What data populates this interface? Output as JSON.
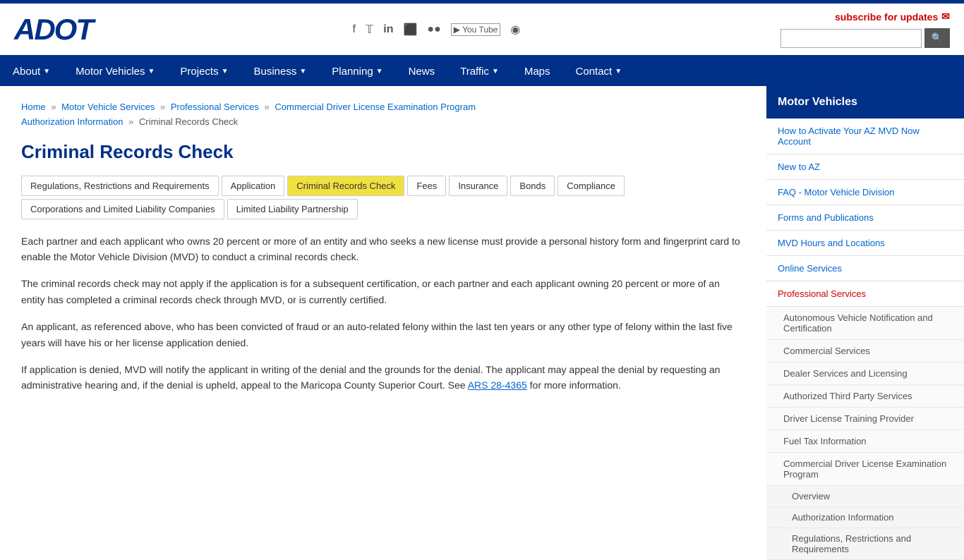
{
  "top_strip": "",
  "logo": {
    "text": "ADOT"
  },
  "social": {
    "icons": [
      {
        "name": "facebook",
        "symbol": "f"
      },
      {
        "name": "twitter",
        "symbol": "𝕏"
      },
      {
        "name": "linkedin",
        "symbol": "in"
      },
      {
        "name": "instagram",
        "symbol": "📷"
      },
      {
        "name": "flickr",
        "symbol": "✿✿"
      },
      {
        "name": "youtube",
        "symbol": "▶"
      },
      {
        "name": "rss",
        "symbol": "◉"
      }
    ]
  },
  "top_right": {
    "subscribe_label": "subscribe for updates",
    "search_placeholder": ""
  },
  "search_btn_label": "🔍",
  "nav": {
    "items": [
      {
        "label": "About",
        "has_arrow": true
      },
      {
        "label": "Motor Vehicles",
        "has_arrow": true
      },
      {
        "label": "Projects",
        "has_arrow": true
      },
      {
        "label": "Business",
        "has_arrow": true
      },
      {
        "label": "Planning",
        "has_arrow": true
      },
      {
        "label": "News",
        "has_arrow": false
      },
      {
        "label": "Traffic",
        "has_arrow": true
      },
      {
        "label": "Maps",
        "has_arrow": false
      },
      {
        "label": "Contact",
        "has_arrow": true
      }
    ]
  },
  "breadcrumb": {
    "items": [
      {
        "label": "Home",
        "href": "#"
      },
      {
        "label": "Motor Vehicle Services",
        "href": "#"
      },
      {
        "label": "Professional Services",
        "href": "#"
      },
      {
        "label": "Commercial Driver License Examination Program",
        "href": "#"
      },
      {
        "label": "Authorization Information",
        "href": "#"
      },
      {
        "label": "Criminal Records Check",
        "href": "#",
        "current": true
      }
    ]
  },
  "page_title": "Criminal Records Check",
  "tabs": [
    {
      "label": "Regulations, Restrictions and Requirements",
      "active": false
    },
    {
      "label": "Application",
      "active": false
    },
    {
      "label": "Criminal Records Check",
      "active": true
    },
    {
      "label": "Fees",
      "active": false
    },
    {
      "label": "Insurance",
      "active": false
    },
    {
      "label": "Bonds",
      "active": false
    },
    {
      "label": "Compliance",
      "active": false
    },
    {
      "label": "Corporations and Limited Liability Companies",
      "active": false
    },
    {
      "label": "Limited Liability Partnership",
      "active": false
    }
  ],
  "body": {
    "paragraphs": [
      "Each partner and each applicant who owns 20 percent or more of an entity and who seeks a new license must provide a personal history form and fingerprint card to enable the Motor Vehicle Division (MVD) to conduct a criminal records check.",
      "The criminal records check may not apply if the application is for a subsequent certification, or each partner and each applicant owning 20 percent or more of an entity has completed a criminal records check through MVD, or is currently certified.",
      "An applicant, as referenced above, who has been convicted of fraud or an auto-related felony within the last ten years or any other type of felony within the last five years will have his or her license application denied.",
      "If application is denied, MVD will notify the applicant in writing of the denial and the grounds for the denial. The applicant may appeal the denial by requesting an administrative hearing and, if the denial is upheld, appeal to the Maricopa County Superior Court. See ARS 28-4365 for more information."
    ],
    "link_text": "ARS 28-4365",
    "link_suffix": " for more information."
  },
  "sidebar": {
    "header": "Motor Vehicles",
    "main_links": [
      {
        "label": "How to Activate Your AZ MVD Now Account",
        "active": false
      },
      {
        "label": "New to AZ",
        "active": false
      },
      {
        "label": "FAQ - Motor Vehicle Division",
        "active": false
      },
      {
        "label": "Forms and Publications",
        "active": false
      },
      {
        "label": "MVD Hours and Locations",
        "active": false
      },
      {
        "label": "Online Services",
        "active": false
      },
      {
        "label": "Professional Services",
        "active": true
      }
    ],
    "sub_links": [
      {
        "label": "Autonomous Vehicle Notification and Certification"
      },
      {
        "label": "Commercial Services"
      },
      {
        "label": "Dealer Services and Licensing"
      },
      {
        "label": "Authorized Third Party Services"
      },
      {
        "label": "Driver License Training Provider"
      },
      {
        "label": "Fuel Tax Information"
      },
      {
        "label": "Commercial Driver License Examination Program"
      }
    ],
    "sub_sub_links": [
      {
        "label": "Overview"
      },
      {
        "label": "Authorization Information"
      },
      {
        "label": "Regulations, Restrictions and Requirements"
      }
    ]
  }
}
